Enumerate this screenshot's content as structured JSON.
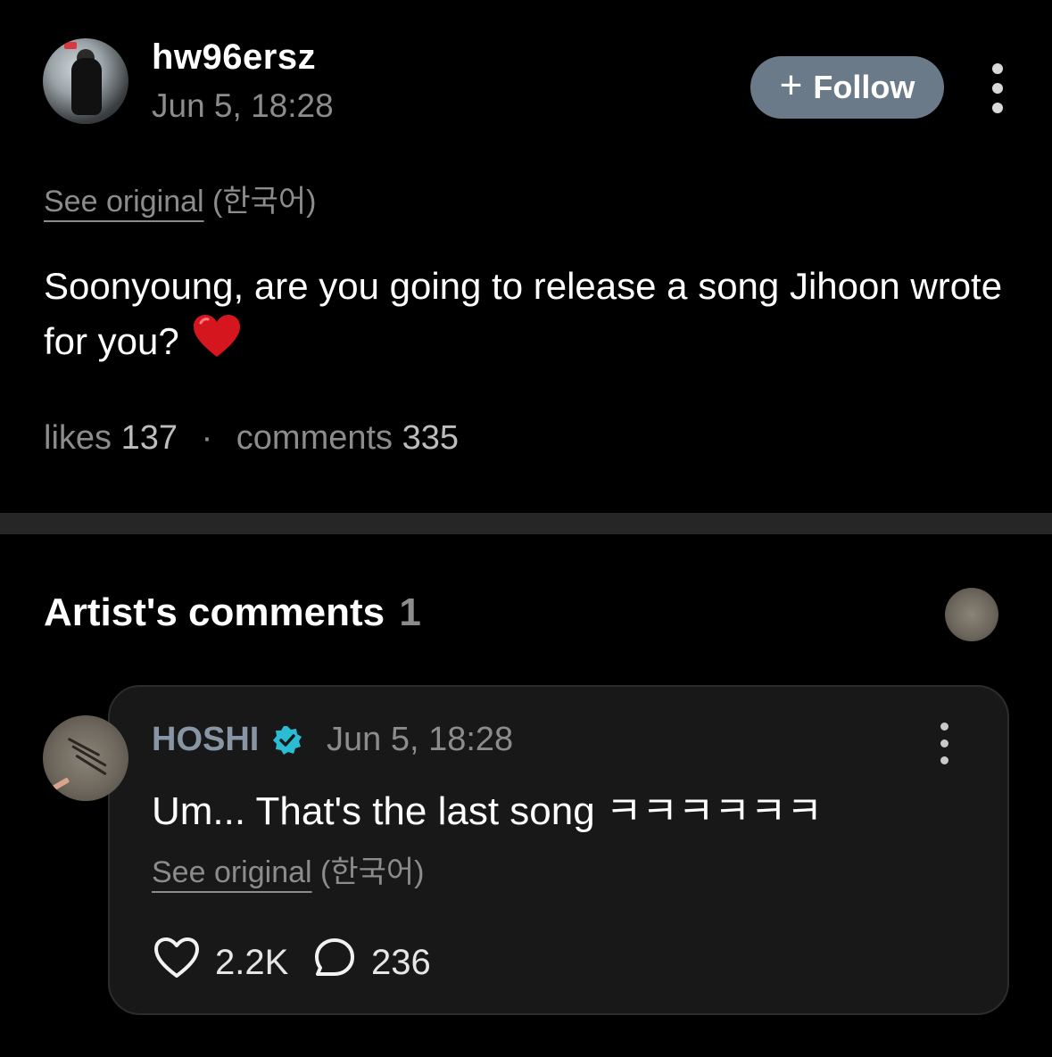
{
  "post": {
    "username": "hw96ersz",
    "date": "Jun 5, 18:28",
    "follow_label": "Follow",
    "follow_plus": "+",
    "see_original": "See original",
    "language": "(한국어)",
    "text": "Soonyoung, are you going to release a song Jihoon wrote for you?",
    "emoji": "heart",
    "likes_label": "likes",
    "likes_count": "137",
    "separator": "·",
    "comments_label": "comments",
    "comments_count": "335"
  },
  "artist_comments": {
    "title": "Artist's comments",
    "count": "1"
  },
  "comment": {
    "name": "HOSHI",
    "verified": true,
    "date": "Jun 5, 18:28",
    "text": "Um... That's the last song ㅋㅋㅋㅋㅋㅋ",
    "see_original": "See original",
    "language": "(한국어)",
    "likes": "2.2K",
    "replies": "236"
  },
  "colors": {
    "background": "#000000",
    "follow_button": "#6b7a89",
    "verified_badge": "#2bbcd4",
    "heart_emoji": "#d6161f",
    "artist_name": "#8795a5",
    "card": "#181818"
  }
}
